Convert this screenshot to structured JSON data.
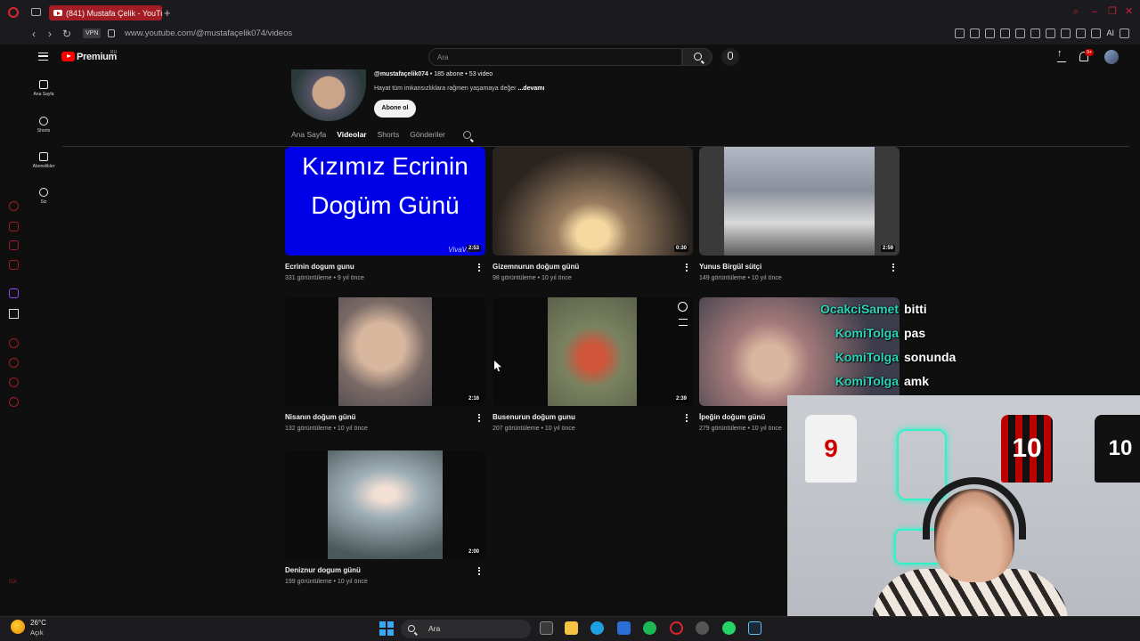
{
  "browser": {
    "tab_title": "(841) Mustafa Çelik - YouTube",
    "vpn_label": "VPN",
    "url": "www.youtube.com/@mustafaçelik074/videos",
    "ai_label": "AI"
  },
  "youtube": {
    "brand": "Premium",
    "brand_region": "RU",
    "search_placeholder": "Ara",
    "notification_count": "9+",
    "guide": [
      {
        "label": "Ana Sayfa",
        "icon": "home-icon"
      },
      {
        "label": "Shorts",
        "icon": "shorts-icon"
      },
      {
        "label": "Abonelikler",
        "icon": "subscriptions-icon"
      },
      {
        "label": "Siz",
        "icon": "you-icon"
      }
    ]
  },
  "channel": {
    "handle": "@mustafaçelik074",
    "stats": " • 185 abone • 53 video",
    "description": "Hayat tüm imkansızlıklara rağmen yaşamaya değer ",
    "more_label": "...devamı",
    "subscribe_label": "Abone ol",
    "tabs": [
      "Ana Sayfa",
      "Videolar",
      "Shorts",
      "Gönderiler"
    ],
    "active_tab": "Videolar"
  },
  "videos": [
    {
      "title": "Ecrinin dogum gunu",
      "meta": "331 görüntüleme • 9 yıl önce",
      "duration": "2:53",
      "thumb_text_1": "Kızımız Ecrinin",
      "thumb_text_2": "Dogüm Günü",
      "thumb_watermark": "VivaVideo"
    },
    {
      "title": "Gizemnurun doğum günü",
      "meta": "98 görüntüleme • 10 yıl önce",
      "duration": "0:30"
    },
    {
      "title": "Yunus Birgül sütçi",
      "meta": "149 görüntüleme • 10 yıl önce",
      "duration": "2:59"
    },
    {
      "title": "Nisanın doğum günü",
      "meta": "132 görüntüleme • 10 yıl önce",
      "duration": "2:16"
    },
    {
      "title": "Busenurun doğum gunu",
      "meta": "207 görüntüleme • 10 yıl önce",
      "duration": "2:39"
    },
    {
      "title": "İpeğin doğum günü",
      "meta": "279 görüntüleme • 10 yıl önce",
      "duration": ""
    },
    {
      "title": "Deniznur dogum günü",
      "meta": "199 görüntüleme • 10 yıl önce",
      "duration": "2:00"
    }
  ],
  "stream_chat": [
    {
      "user": "OcakciSamet",
      "message": "bitti"
    },
    {
      "user": "KomiTolga",
      "message": "pas"
    },
    {
      "user": "KomiTolga",
      "message": "sonunda"
    },
    {
      "user": "KomiTolga",
      "message": "amk"
    }
  ],
  "webcam": {
    "jersey_numbers": [
      "9",
      "10",
      "10"
    ]
  },
  "taskbar": {
    "temperature": "26°C",
    "weather": "Açık",
    "search_placeholder": "Ara"
  },
  "colors": {
    "accent_red": "#ff0000",
    "chat_name": "#2bd4b8",
    "opera_red": "#e0242e"
  }
}
